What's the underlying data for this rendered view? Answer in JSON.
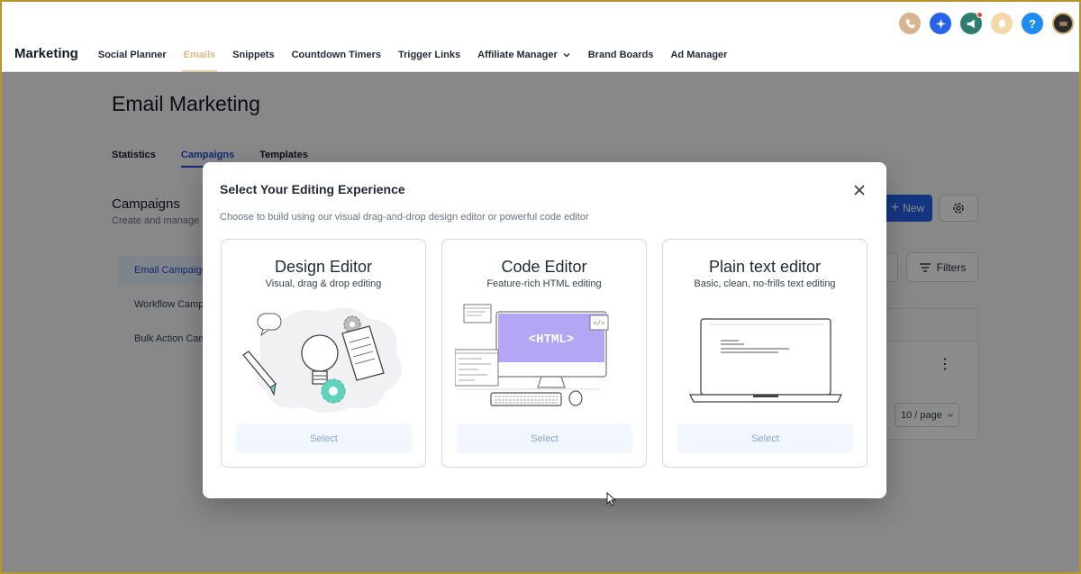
{
  "header": {
    "brand": "Marketing",
    "nav": [
      {
        "label": "Social Planner",
        "active": false
      },
      {
        "label": "Emails",
        "active": true
      },
      {
        "label": "Snippets",
        "active": false
      },
      {
        "label": "Countdown Timers",
        "active": false
      },
      {
        "label": "Trigger Links",
        "active": false
      },
      {
        "label": "Affiliate Manager",
        "active": false,
        "dropdown": true
      },
      {
        "label": "Brand Boards",
        "active": false
      },
      {
        "label": "Ad Manager",
        "active": false
      }
    ],
    "icons": [
      {
        "name": "phone-icon",
        "color": "#d9b48f"
      },
      {
        "name": "sparkle-icon",
        "color": "#2563eb"
      },
      {
        "name": "megaphone-icon",
        "color": "#2f7d6e"
      },
      {
        "name": "bell-icon",
        "color": "#f3d9a8"
      },
      {
        "name": "help-icon",
        "color": "#1d8cf0"
      },
      {
        "name": "avatar-icon",
        "color": "#2b2b2b"
      }
    ],
    "help_glyph": "?"
  },
  "page": {
    "title": "Email Marketing",
    "tabs": [
      "Statistics",
      "Campaigns",
      "Templates"
    ],
    "section_title": "Campaigns",
    "section_subtitle": "Create and manage",
    "side_items": [
      "Email Campaign",
      "Workflow Camp",
      "Bulk Action Cam"
    ],
    "new_button": "New",
    "filters_button": "Filters",
    "pager": "10 / page",
    "kebab": "⋮"
  },
  "modal": {
    "title": "Select Your Editing Experience",
    "description": "Choose to build using our visual drag-and-drop design editor or powerful code editor",
    "cards": [
      {
        "title": "Design Editor",
        "subtitle": "Visual, drag & drop editing",
        "button": "Select"
      },
      {
        "title": "Code Editor",
        "subtitle": "Feature-rich HTML editing",
        "button": "Select",
        "art_text": "<HTML>"
      },
      {
        "title": "Plain text editor",
        "subtitle": "Basic, clean, no-frills text editing",
        "button": "Select"
      }
    ]
  },
  "colors": {
    "accent": "#2563eb",
    "active_nav": "#d9b98a",
    "html_block": "#b5a6f5",
    "select_bg": "#f2f6fd",
    "select_text": "#8aa6d4"
  }
}
